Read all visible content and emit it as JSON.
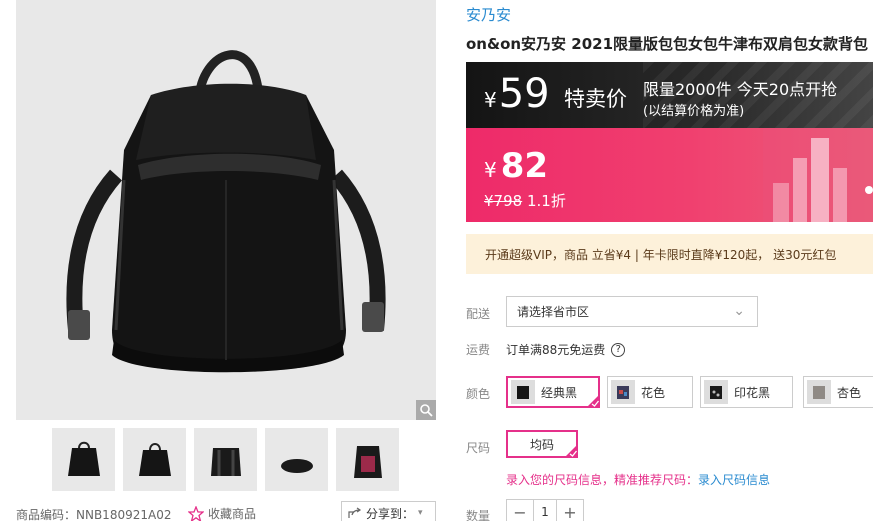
{
  "product": {
    "brand": "安乃安",
    "title": "on&on安乃安 2021限量版包包女包牛津布双肩包女款背包",
    "sku_label": "商品编码：NNB180921A02",
    "favorite_label": "收藏商品",
    "share_label": "分享到："
  },
  "promo": {
    "currency": "¥",
    "price": "59",
    "tag": "特卖价",
    "note1": "限量2000件 今天20点开抢",
    "note2": "(以结算价格为准)"
  },
  "price": {
    "currency": "¥",
    "current": "82",
    "original": "¥798",
    "discount": "1.1折"
  },
  "vip_text": "开通超级VIP，商品 立省¥4 | 年卡限时直降¥120起， 送30元红包",
  "delivery": {
    "label": "配送",
    "placeholder": "请选择省市区"
  },
  "shipping": {
    "label": "运费",
    "text": "订单满88元免运费",
    "help": "?"
  },
  "color": {
    "label": "颜色",
    "options": [
      {
        "name": "经典黑",
        "selected": true
      },
      {
        "name": "花色",
        "selected": false
      },
      {
        "name": "印花黑",
        "selected": false
      },
      {
        "name": "杏色",
        "selected": false
      }
    ]
  },
  "size": {
    "label": "尺码",
    "option": "均码",
    "hint_prefix": "录入您的尺码信息，精准推荐尺码：",
    "hint_link": "录入尺码信息"
  },
  "quantity": {
    "label": "数量",
    "minus": "−",
    "value": "1",
    "plus": "+"
  },
  "colors": {
    "accent": "#e5308a",
    "link": "#2a8bd0",
    "promo_bg": "#1e1e1e",
    "price_bg": "#ee2a69",
    "vip_bg": "#fdf1da"
  }
}
